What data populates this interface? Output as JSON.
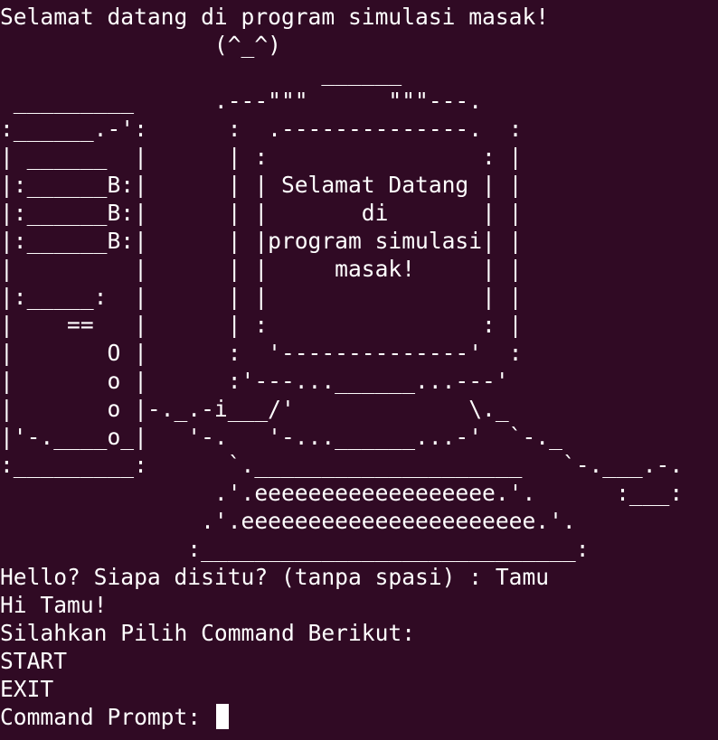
{
  "terminal": {
    "lines": [
      "Selamat datang di program simulasi masak!",
      "                (^_^)",
      "                        ______",
      " _________      .---\"\"\"      \"\"\"---.",
      ":______.-':      :  .--------------.  :",
      "| ______  |      | :                : |",
      "|:______B:|      | | Selamat Datang | |",
      "|:______B:|      | |       di       | |",
      "|:______B:|      | |program simulasi| |",
      "|         |      | |     masak!     | |",
      "|:_____:  |      | |                | |",
      "|    ==   |      | :                : |",
      "|       O |      :  '--------------'  :",
      "|       o |      :'---...______...---'",
      "|       o |-._.-i___/'             \\._",
      "|'-.____o_|   '-.   '-...______...-'  `-._",
      ":_________:      `.____________________   `-.___.-.",
      "                .'.eeeeeeeeeeeeeeeeee.'.      :___:",
      "               .'.eeeeeeeeeeeeeeeeeeeeee.'.",
      "              :____________________________:",
      "Hello? Siapa disitu? (tanpa spasi) : Tamu",
      "Hi Tamu!",
      "Silahkan Pilih Command Berikut:",
      "START",
      "EXIT",
      "Command Prompt: "
    ]
  }
}
